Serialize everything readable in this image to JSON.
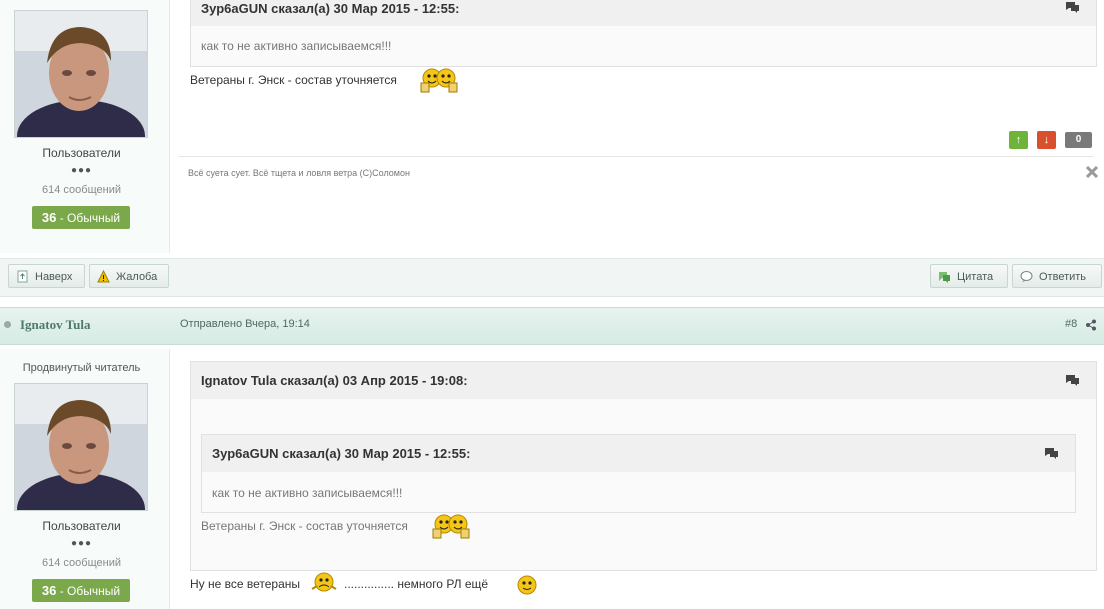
{
  "post1": {
    "author_box": {
      "group": "Пользователи",
      "pips": "●●●",
      "post_count": "614 сообщений",
      "rep_value": "36",
      "rep_label": "- Обычный"
    },
    "quote": {
      "header": "Зур6аGUN сказал(а) 30 Мар 2015 - 12:55:",
      "body": "как то не активно записываемся!!!"
    },
    "text": "Ветераны г. Энск - состав уточняется",
    "votes": {
      "up": "↑",
      "down": "↓",
      "score": "0"
    },
    "signature": "Всё суета сует. Всё тщета и ловля ветра (С)Соломон"
  },
  "actions": {
    "top_label": "Наверх",
    "report_label": "Жалоба",
    "quote_label": "Цитата",
    "reply_label": "Ответить"
  },
  "post2": {
    "author": "Ignatov Tula",
    "posted": "Отправлено Вчера, 19:14",
    "number": "#8",
    "author_box": {
      "rank": "Продвинутый читатель",
      "group": "Пользователи",
      "pips": "●●●",
      "post_count": "614 сообщений",
      "rep_value": "36",
      "rep_label": "- Обычный"
    },
    "outer_quote": {
      "header": "Ignatov Tula сказал(а) 03 Апр 2015 - 19:08:",
      "inner_header": "Зур6аGUN сказал(а) 30 Мар 2015 - 12:55:",
      "inner_body": "как то не активно записываемся!!!",
      "text": "Ветераны г. Энск - состав уточняется"
    },
    "text_part1": "Ну не все ветераны",
    "text_part2": "............... немного РЛ ещё"
  },
  "colors": {
    "accent": "#7ba84a",
    "header_bg": "#dceee8",
    "author": "#4f7a6a"
  }
}
